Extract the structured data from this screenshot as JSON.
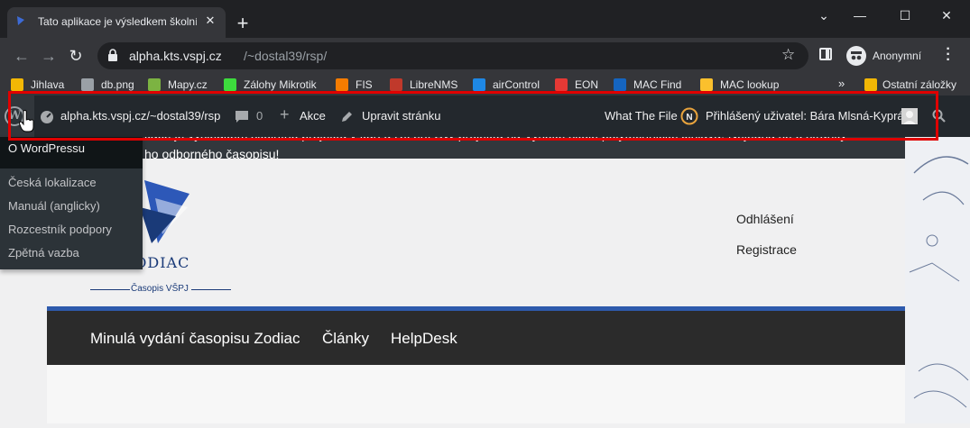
{
  "browser": {
    "tab_title": "Tato aplikace je výsledkem školní",
    "url_host": "alpha.kts.vspj.cz",
    "url_path": "/~dostal39/rsp/",
    "profile_label": "Anonymní",
    "window_controls": [
      "minimize-icon",
      "maximize-icon",
      "close-icon"
    ]
  },
  "bookmarks": [
    {
      "label": "Jihlava",
      "icon": "folder-icon",
      "color": "#f2b705"
    },
    {
      "label": "db.png",
      "icon": "globe-icon",
      "color": "#9aa0a6"
    },
    {
      "label": "Mapy.cz",
      "icon": "mapy-icon",
      "color": "#7cb342"
    },
    {
      "label": "Zálohy Mikrotik",
      "icon": "z-icon",
      "color": "#3ddc3d"
    },
    {
      "label": "FIS",
      "icon": "fis-icon",
      "color": "#f57c00"
    },
    {
      "label": "LibreNMS",
      "icon": "librenms-icon",
      "color": "#c0392b"
    },
    {
      "label": "airControl",
      "icon": "aircontrol-icon",
      "color": "#1e88e5"
    },
    {
      "label": "EON",
      "icon": "eon-icon",
      "color": "#e53935"
    },
    {
      "label": "MAC Find",
      "icon": "macfind-icon",
      "color": "#1565c0"
    },
    {
      "label": "MAC lookup",
      "icon": "maclookup-icon",
      "color": "#fbc02d"
    }
  ],
  "bookmarks_more": "»",
  "other_bookmarks": "Ostatní záložky",
  "wp_bar": {
    "site": "alpha.kts.vspj.cz/~dostal39/rsp",
    "comments_count": "0",
    "new_label": "Akce",
    "edit_label": "Upravit stránku",
    "plugin_label": "What The File",
    "user_label": "Přihlášený uživatel: Bára Mlsná-Kyprá"
  },
  "wp_menu": [
    "O WordPressu",
    "Česká lokalizace",
    "Manuál (anglicky)",
    "Rozcestník podpory",
    "Zpětná vazba"
  ],
  "notice": {
    "line1": "kace je výsledkem školního projektu v kurzu Řízení SW projektů na Vysoké škole polytechnické Jihlava. Nejedná se o stránky",
    "line2": "ho odborného časopisu!"
  },
  "logo": {
    "title": "PIS ZODIAC",
    "subtitle": "Časopis VŠPJ"
  },
  "account": {
    "logout": "Odhlášení",
    "register": "Registrace"
  },
  "site_nav": [
    "Minulá vydání časopisu Zodiac",
    "Články",
    "HelpDesk"
  ],
  "colors": {
    "highlight": "#e00000",
    "accent_blue": "#2e5aac",
    "wp_bar": "#23282d"
  }
}
